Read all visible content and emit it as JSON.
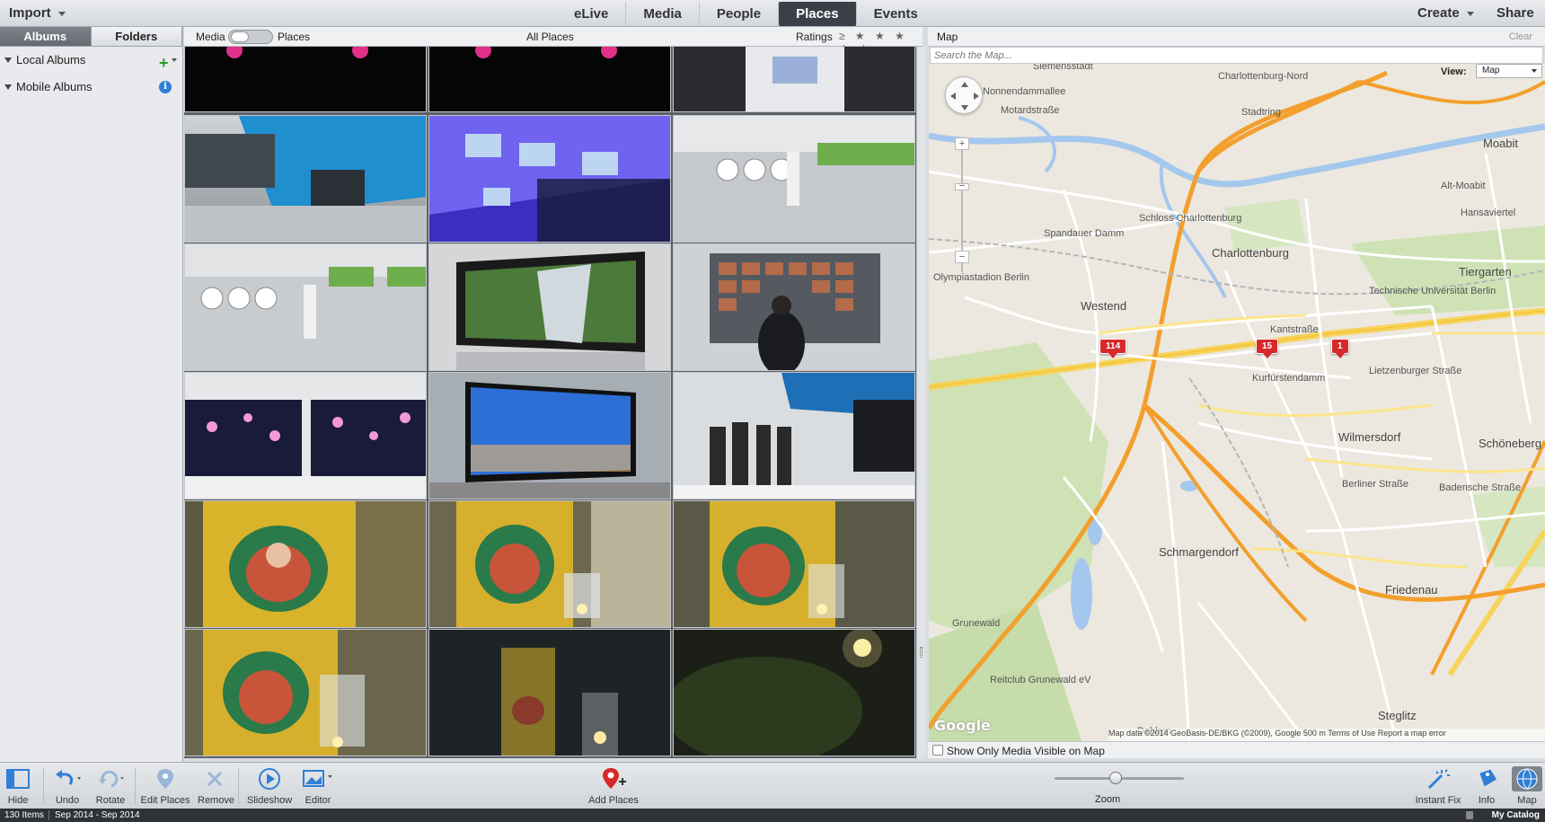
{
  "header": {
    "import_label": "Import",
    "tabs": [
      {
        "label": "eLive",
        "active": false
      },
      {
        "label": "Media",
        "active": false
      },
      {
        "label": "People",
        "active": false
      },
      {
        "label": "Places",
        "active": true
      },
      {
        "label": "Events",
        "active": false
      }
    ],
    "create_label": "Create",
    "share_label": "Share"
  },
  "sidebar": {
    "tabs": [
      "Albums",
      "Folders"
    ],
    "active_tab": "Albums",
    "local_albums": "Local Albums",
    "mobile_albums": "Mobile Albums"
  },
  "media_bar": {
    "media_label": "Media",
    "places_label": "Places",
    "all_places": "All Places",
    "ratings_label": "Ratings",
    "ratings_symbol": "≥ ★ ★ ★ ★ ★"
  },
  "map": {
    "title": "Map",
    "clear_label": "Clear",
    "search_placeholder": "Search the Map...",
    "view_label": "View:",
    "view_value": "Map",
    "google_logo": "Google",
    "attribution": "Map data ©2014 GeoBasis-DE/BKG (©2009), Google    500 m          Terms of Use    Report a map error",
    "show_only_label": "Show Only Media Visible on Map",
    "pins": [
      "114",
      "15",
      "1"
    ],
    "places": [
      "Siemensstadt",
      "Charlottenburg-Nord",
      "Nonnendammallee",
      "Motardstraße",
      "Stadtring",
      "Moabit",
      "Schloss Charlottenburg",
      "Spandauer Damm",
      "Charlottenburg",
      "Tiergarten",
      "Olympiastadion Berlin",
      "Westend",
      "Technische Universität Berlin",
      "Kantstraße",
      "Kurfürstendamm",
      "Lietzenburger Straße",
      "Wilmersdorf",
      "Schöneberg",
      "Berliner Straße",
      "Badensche Straße",
      "Schmargendorf",
      "Grunewald",
      "Friedenau",
      "Reitclub Grunewald eV",
      "Steglitz",
      "Dahlem",
      "Alt-Moabit",
      "Hansaviertel"
    ]
  },
  "toolbar": {
    "hide": "Hide",
    "undo": "Undo",
    "rotate": "Rotate",
    "edit_places": "Edit Places",
    "remove": "Remove",
    "slideshow": "Slideshow",
    "editor": "Editor",
    "add_places": "Add Places",
    "zoom": "Zoom",
    "instant_fix": "Instant Fix",
    "info": "Info",
    "map": "Map"
  },
  "status": {
    "items": "130 Items",
    "range": "Sep 2014 - Sep 2014",
    "catalog": "My Catalog"
  },
  "colors": {
    "active_tab_bg": "#3b4048",
    "pin_red": "#d7282a",
    "accent_blue": "#2f7fd6"
  }
}
